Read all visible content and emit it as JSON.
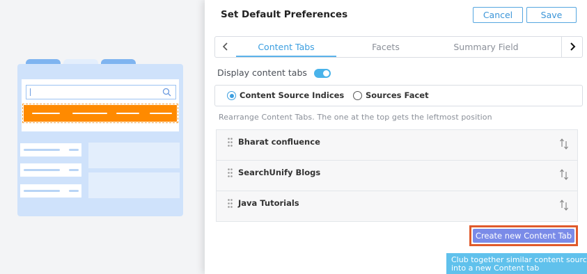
{
  "panel": {
    "title": "Set Default Preferences",
    "cancel_label": "Cancel",
    "save_label": "Save"
  },
  "tabs": {
    "items": [
      {
        "label": "Content Tabs",
        "active": true
      },
      {
        "label": "Facets",
        "active": false
      },
      {
        "label": "Summary Field",
        "active": false
      }
    ],
    "prev_icon": "chevron-left-icon",
    "next_icon": "chevron-right-icon"
  },
  "display_toggle": {
    "label": "Display content tabs",
    "on": true
  },
  "radio_group": {
    "options": [
      {
        "label": "Content Source Indices",
        "checked": true
      },
      {
        "label": "Sources Facet",
        "checked": false
      }
    ]
  },
  "hint": "Rearrange Content Tabs. The one at the top gets the leftmost position",
  "content_tabs": [
    {
      "name": "Bharat confluence"
    },
    {
      "name": "SearchUnify Blogs"
    },
    {
      "name": "Java Tutorials"
    }
  ],
  "create_button": {
    "label": "Create new Content Tab"
  },
  "tooltip": {
    "line1": "Club together similar content sourc",
    "line2": "into a new Content tab"
  },
  "colors": {
    "accent": "#3b9ee0",
    "toggle": "#49b3ea",
    "create_button": "#7a8be8",
    "highlight_border": "#e05a2b",
    "tooltip": "#60c1ec",
    "illustration_orange": "#ff8a00",
    "illustration_blue": "#cfe2fb"
  }
}
